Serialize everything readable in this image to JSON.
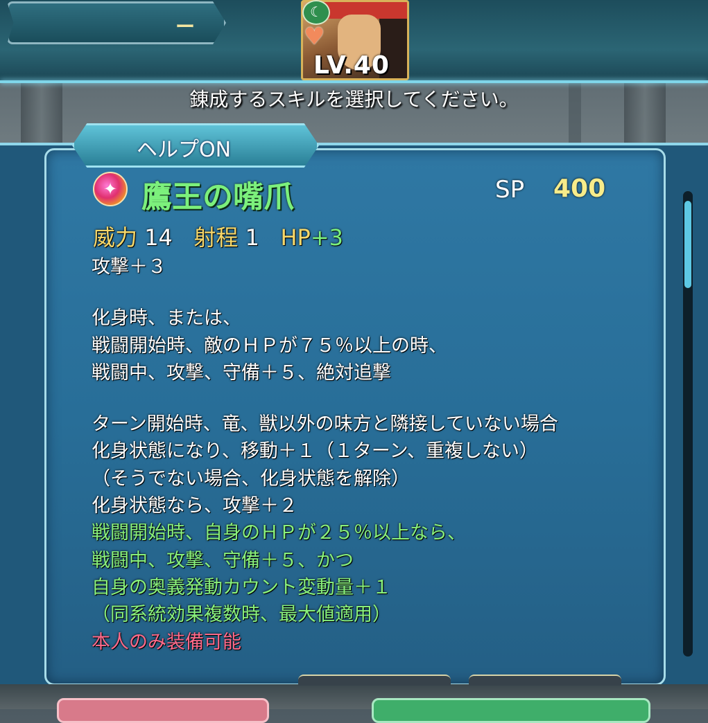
{
  "header": {
    "name_plate_text": "ー",
    "level": "LV.40",
    "instruction": "錬成するスキルを選択してください。"
  },
  "help_tab": {
    "label": "ヘルプON"
  },
  "skill": {
    "name": "鷹王の嘴爪",
    "sp_label": "SP",
    "sp_value": "400",
    "stats": {
      "might_label": "威力",
      "might_value": "14",
      "range_label": "射程",
      "range_value": "1",
      "hp_label": "HP",
      "hp_value": "+3"
    },
    "description": [
      {
        "text": "攻撃＋３",
        "color": "white"
      },
      {
        "text": "",
        "color": "blank"
      },
      {
        "text": "化身時、または、",
        "color": "white"
      },
      {
        "text": "戦闘開始時、敵のＨＰが７５％以上の時、",
        "color": "white"
      },
      {
        "text": "戦闘中、攻撃、守備＋５、絶対追撃",
        "color": "white"
      },
      {
        "text": "",
        "color": "blank"
      },
      {
        "text": "ターン開始時、竜、獣以外の味方と隣接していない場合",
        "color": "white"
      },
      {
        "text": "化身状態になり、移動＋１（１ターン、重複しない）",
        "color": "white"
      },
      {
        "text": "（そうでない場合、化身状態を解除）",
        "color": "white"
      },
      {
        "text": "化身状態なら、攻撃＋２",
        "color": "white"
      },
      {
        "text": "戦闘開始時、自身のＨＰが２５％以上なら、",
        "color": "green"
      },
      {
        "text": "戦闘中、攻撃、守備＋５、かつ",
        "color": "green"
      },
      {
        "text": "自身の奥義発動カウント変動量＋１",
        "color": "green"
      },
      {
        "text": "（同系統効果複数時、最大値適用）",
        "color": "green"
      },
      {
        "text": "本人のみ装備可能",
        "color": "red"
      }
    ]
  },
  "colors": {
    "skill_name": "#7cf07c",
    "sp_value": "#f7ec8a",
    "refine_effect": "#8af27c",
    "exclusive": "#ff6a8a"
  }
}
